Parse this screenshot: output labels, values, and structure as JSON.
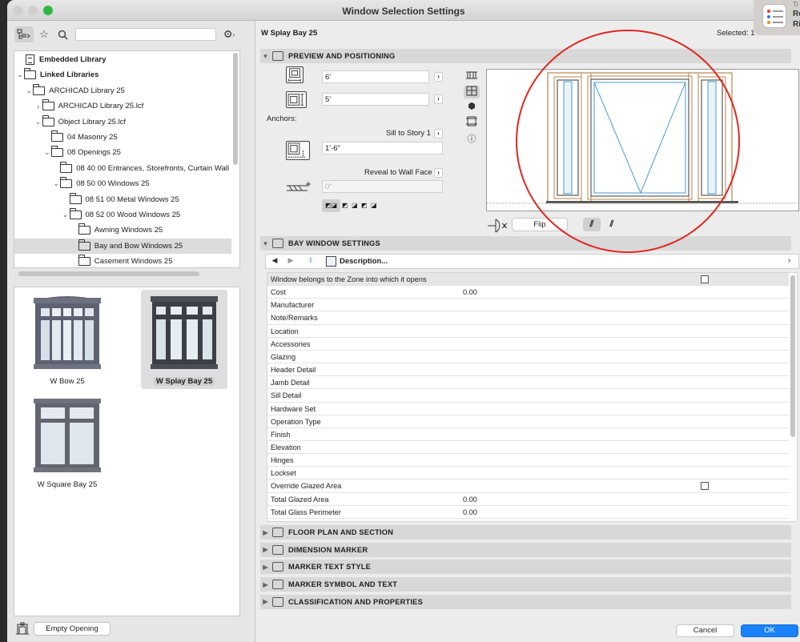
{
  "window": {
    "title": "Window Selection Settings"
  },
  "notification": {
    "line1": "Re",
    "line2": "Ri",
    "line0": "Ti"
  },
  "library": {
    "search_placeholder": "",
    "tree": [
      {
        "label": "Embedded Library",
        "bold": true,
        "icon": "doc",
        "indent": 0,
        "chevron": ""
      },
      {
        "label": "Linked Libraries",
        "bold": true,
        "icon": "folder",
        "indent": 0,
        "chevron": "open"
      },
      {
        "label": "ARCHICAD Library 25",
        "icon": "folder",
        "indent": 1,
        "chevron": "open"
      },
      {
        "label": "ARCHICAD Library 25.lcf",
        "icon": "folder",
        "indent": 2,
        "chevron": "closed"
      },
      {
        "label": "Object Library 25.lcf",
        "icon": "folder",
        "indent": 2,
        "chevron": "open"
      },
      {
        "label": "04 Masonry 25",
        "icon": "folder",
        "indent": 3,
        "chevron": ""
      },
      {
        "label": "08 Openings 25",
        "icon": "folder",
        "indent": 3,
        "chevron": "open"
      },
      {
        "label": "08 40 00 Entrances, Storefronts, Curtain Wall",
        "icon": "folder",
        "indent": 4,
        "chevron": ""
      },
      {
        "label": "08 50 00 Windows 25",
        "icon": "folder",
        "indent": 4,
        "chevron": "open"
      },
      {
        "label": "08 51 00 Metal Windows 25",
        "icon": "folder",
        "indent": 5,
        "chevron": ""
      },
      {
        "label": "08 52 00 Wood Windows 25",
        "icon": "folder",
        "indent": 5,
        "chevron": "open"
      },
      {
        "label": "Awning Windows 25",
        "icon": "folder",
        "indent": 6,
        "chevron": ""
      },
      {
        "label": "Bay and Bow Windows 25",
        "icon": "folder",
        "indent": 6,
        "chevron": "",
        "selected": true
      },
      {
        "label": "Casement Windows 25",
        "icon": "folder",
        "indent": 6,
        "chevron": ""
      }
    ],
    "thumbnails": [
      {
        "label": "W Bow 25"
      },
      {
        "label": "W Splay Bay 25",
        "selected": true
      },
      {
        "label": "W Square Bay 25"
      }
    ],
    "empty_opening_label": "Empty Opening"
  },
  "settings": {
    "element_name": "W Splay Bay 25",
    "selected_label": "Selected: 1",
    "preview_section": {
      "title": "PREVIEW AND POSITIONING",
      "width_value": "6'",
      "height_value": "5'",
      "anchors_label": "Anchors:",
      "sill_label": "Sill to Story 1",
      "sill_value": "1'-6\"",
      "reveal_label": "Reveal to Wall Face",
      "reveal_value": "0\"",
      "flip_label": "Flip"
    },
    "bay_section": {
      "title": "BAY WINDOW SETTINGS",
      "description_label": "Description..."
    },
    "properties": [
      {
        "name": "Window belongs to the Zone into which it opens",
        "value": "",
        "checkbox": true
      },
      {
        "name": "Cost",
        "value": "0.00"
      },
      {
        "name": "Manufacturer",
        "value": ""
      },
      {
        "name": "Note/Remarks",
        "value": ""
      },
      {
        "name": "Location",
        "value": ""
      },
      {
        "name": "Accessories",
        "value": ""
      },
      {
        "name": "Glazing",
        "value": ""
      },
      {
        "name": "Header Detail",
        "value": ""
      },
      {
        "name": "Jamb Detail",
        "value": ""
      },
      {
        "name": "Sill Detail",
        "value": ""
      },
      {
        "name": "Hardware Set",
        "value": ""
      },
      {
        "name": "Operation Type",
        "value": ""
      },
      {
        "name": "Finish",
        "value": ""
      },
      {
        "name": "Elevation",
        "value": ""
      },
      {
        "name": "Hinges",
        "value": ""
      },
      {
        "name": "Lockset",
        "value": ""
      },
      {
        "name": "Override Glazed Area",
        "value": "",
        "checkbox": true
      },
      {
        "name": "Total Glazed Area",
        "value": "0.00"
      },
      {
        "name": "Total Glass Perimeter",
        "value": "0.00"
      }
    ],
    "collapsed_sections": [
      {
        "title": "FLOOR PLAN AND SECTION",
        "icon": "floor-plan-icon"
      },
      {
        "title": "DIMENSION MARKER",
        "icon": "dimension-marker-icon"
      },
      {
        "title": "MARKER TEXT STYLE",
        "icon": "text-style-icon"
      },
      {
        "title": "MARKER SYMBOL AND TEXT",
        "icon": "marker-symbol-icon"
      },
      {
        "title": "CLASSIFICATION AND PROPERTIES",
        "icon": "classification-icon"
      }
    ]
  },
  "footer": {
    "cancel_label": "Cancel",
    "ok_label": "OK"
  },
  "colors": {
    "accent": "#1a82fb",
    "annotation": "#e0271f",
    "frame": "#b8864b",
    "glass_line": "#4a9ad6"
  }
}
